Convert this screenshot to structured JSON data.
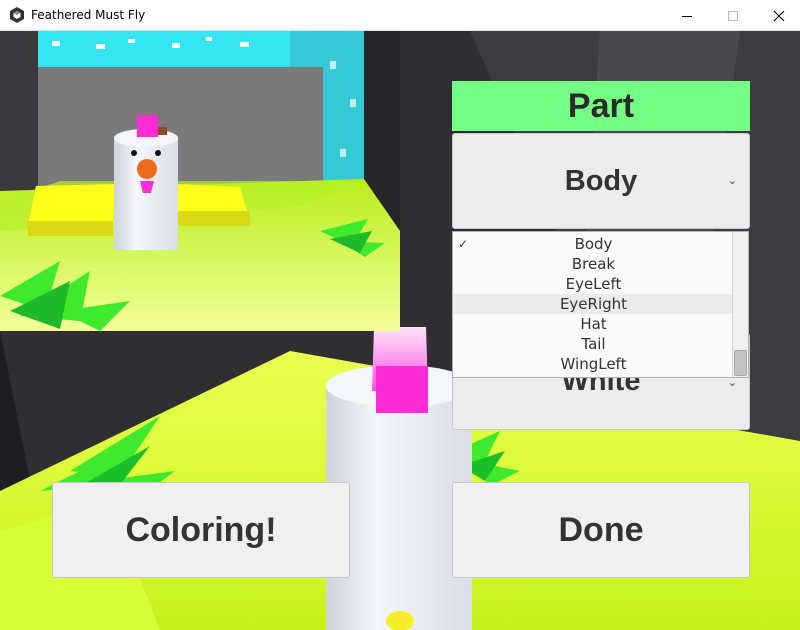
{
  "window": {
    "title": "Feathered Must Fly",
    "app_icon": "unity-icon",
    "controls": [
      "minimize-icon",
      "maximize-icon",
      "close-icon"
    ]
  },
  "part_panel": {
    "header": "Part",
    "part_dropdown": {
      "selected": "Body",
      "options": [
        "Body",
        "Break",
        "EyeLeft",
        "EyeRight",
        "Hat",
        "Tail",
        "WingLeft"
      ],
      "checked_index": 0,
      "hovered_index": 3
    },
    "color_dropdown": {
      "selected": "White"
    }
  },
  "buttons": {
    "coloring": "Coloring!",
    "done": "Done"
  },
  "colors": {
    "header_green": "#74ff86",
    "sky": "#33e6f2",
    "ground": "#d8ff2a",
    "chicken_white": "#e8ecf2",
    "comb_pink": "#ff2cd6",
    "beak_orange": "#f06a1e",
    "wing_yellow": "#ffff1a"
  }
}
